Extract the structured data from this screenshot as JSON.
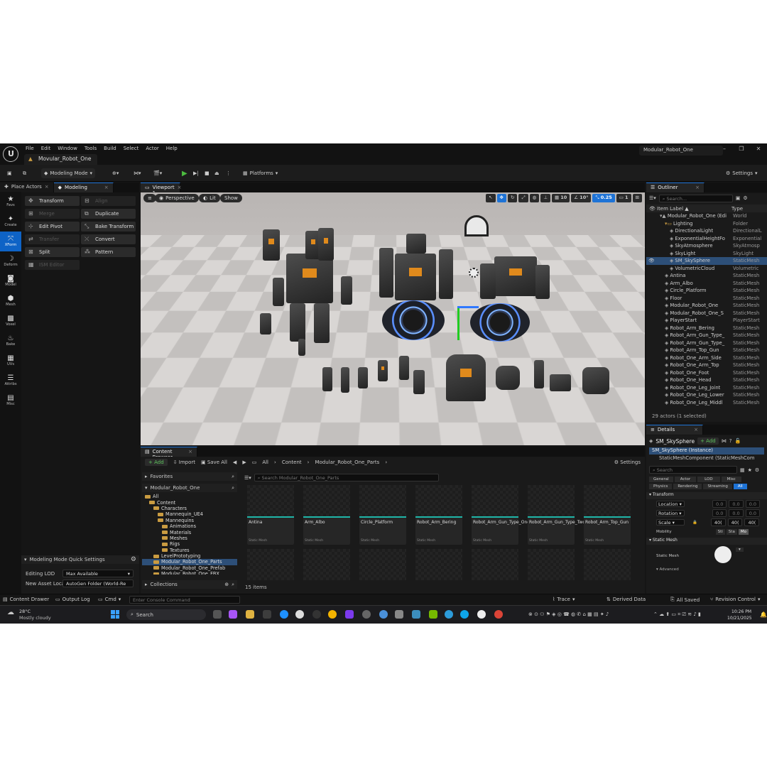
{
  "app": {
    "menus": [
      "File",
      "Edit",
      "Window",
      "Tools",
      "Build",
      "Select",
      "Actor",
      "Help"
    ],
    "project_tab": "Movular_Robot_One",
    "window_title": "Modular_Robot_One",
    "window_controls": [
      "–",
      "❐",
      "✕"
    ]
  },
  "toolbar": {
    "mode": "Modeling Mode",
    "platforms": "Platforms",
    "settings": "Settings"
  },
  "left_panel": {
    "tabs": [
      "Place Actors",
      "Modeling"
    ],
    "strip": [
      {
        "icon": "star-icon",
        "label": "Favs"
      },
      {
        "icon": "create-icon",
        "label": "Create"
      },
      {
        "icon": "xform-icon",
        "label": "XForm"
      },
      {
        "icon": "deform-icon",
        "label": "Deform"
      },
      {
        "icon": "model-icon",
        "label": "Model"
      },
      {
        "icon": "mesh-icon",
        "label": "Mesh"
      },
      {
        "icon": "voxel-icon",
        "label": "Voxel"
      },
      {
        "icon": "bake-icon",
        "label": "Bake"
      },
      {
        "icon": "uvs-icon",
        "label": "UVs"
      },
      {
        "icon": "attribs-icon",
        "label": "Attribs"
      },
      {
        "icon": "misc-icon",
        "label": "Misc"
      }
    ],
    "tools": [
      {
        "label": "Transform",
        "enabled": true
      },
      {
        "label": "Align",
        "enabled": false
      },
      {
        "label": "Merge",
        "enabled": false
      },
      {
        "label": "Duplicate",
        "enabled": true
      },
      {
        "label": "Edit Pivot",
        "enabled": true
      },
      {
        "label": "Bake Transform",
        "enabled": true
      },
      {
        "label": "Transfer",
        "enabled": false
      },
      {
        "label": "Convert",
        "enabled": true
      },
      {
        "label": "Split",
        "enabled": true
      },
      {
        "label": "Pattern",
        "enabled": true
      },
      {
        "label": "ISM Editor",
        "enabled": false
      }
    ],
    "quick_settings": {
      "title": "Modeling Mode Quick Settings",
      "editing_lod_label": "Editing LOD",
      "editing_lod_value": "Max Available",
      "new_asset_label": "New Asset Loca",
      "new_asset_value": "AutoGen Folder (World-Re"
    }
  },
  "viewport": {
    "tab": "Viewport 1",
    "perspective": "Perspective",
    "lit": "Lit",
    "show": "Show",
    "grid_snap": "10",
    "angle_snap": "10°",
    "scale_snap": "0.25",
    "camera_speed": "1"
  },
  "outliner": {
    "title": "Outliner",
    "search_placeholder": "Search...",
    "col_label": "Item Label ▲",
    "col_type": "Type",
    "rows": [
      {
        "name": "Modular_Robot_One (Edi",
        "type": "World",
        "indent": 1
      },
      {
        "name": "Lighting",
        "type": "Folder",
        "indent": 2
      },
      {
        "name": "DirectionalLight",
        "type": "DirectionalL",
        "indent": 3
      },
      {
        "name": "ExponentialHeightFo",
        "type": "Exponential",
        "indent": 3
      },
      {
        "name": "SkyAtmosphere",
        "type": "SkyAtmosp",
        "indent": 3
      },
      {
        "name": "SkyLight",
        "type": "SkyLight",
        "indent": 3
      },
      {
        "name": "SM_SkySphere",
        "type": "StaticMesh",
        "indent": 3,
        "selected": true
      },
      {
        "name": "VolumetricCloud",
        "type": "Volumetric",
        "indent": 3
      },
      {
        "name": "Antina",
        "type": "StaticMesh",
        "indent": 2
      },
      {
        "name": "Arm_Albo",
        "type": "StaticMesh",
        "indent": 2
      },
      {
        "name": "Circle_Platform",
        "type": "StaticMesh",
        "indent": 2
      },
      {
        "name": "Floor",
        "type": "StaticMesh",
        "indent": 2
      },
      {
        "name": "Modular_Robot_One",
        "type": "StaticMesh",
        "indent": 2
      },
      {
        "name": "Modular_Robot_One_S",
        "type": "StaticMesh",
        "indent": 2
      },
      {
        "name": "PlayerStart",
        "type": "PlayerStart",
        "indent": 2
      },
      {
        "name": "Robot_Arm_Bering",
        "type": "StaticMesh",
        "indent": 2
      },
      {
        "name": "Robot_Arm_Gun_Type_",
        "type": "StaticMesh",
        "indent": 2
      },
      {
        "name": "Robot_Arm_Gun_Type_",
        "type": "StaticMesh",
        "indent": 2
      },
      {
        "name": "Robot_Arm_Top_Gun",
        "type": "StaticMesh",
        "indent": 2
      },
      {
        "name": "Robot_One_Arm_Side",
        "type": "StaticMesh",
        "indent": 2
      },
      {
        "name": "Robot_One_Arm_Top",
        "type": "StaticMesh",
        "indent": 2
      },
      {
        "name": "Robot_One_Foot",
        "type": "StaticMesh",
        "indent": 2
      },
      {
        "name": "Robot_One_Head",
        "type": "StaticMesh",
        "indent": 2
      },
      {
        "name": "Robot_One_Leg_Joint",
        "type": "StaticMesh",
        "indent": 2
      },
      {
        "name": "Robot_One_Leg_Lower",
        "type": "StaticMesh",
        "indent": 2
      },
      {
        "name": "Robot_One_Leg_Middl",
        "type": "StaticMesh",
        "indent": 2
      }
    ],
    "footer": "29 actors (1 selected)"
  },
  "details": {
    "title": "Details",
    "actor": "SM_SkySphere",
    "add": "+ Add",
    "instance": "SM_SkySphere (Instance)",
    "component": "StaticMeshComponent (StaticMeshCom",
    "search_placeholder": "Search",
    "filters1": [
      "General",
      "Actor",
      "LOD",
      "Misc"
    ],
    "filters2": [
      "Physics",
      "Rendering",
      "Streaming",
      "All"
    ],
    "transform": "Transform",
    "location": "Location",
    "rotation": "Rotation",
    "scale": "Scale",
    "loc_vals": [
      "0.0",
      "0.0",
      "0.0"
    ],
    "rot_vals": [
      "0.0",
      "0.0",
      "0.0"
    ],
    "scale_vals": [
      "40(",
      "40(",
      "40("
    ],
    "mobility": "Mobility",
    "mobility_opts": [
      "Sti",
      "Sta",
      "Mo"
    ],
    "static_mesh_header": "Static Mesh",
    "static_mesh_label": "Static Mesh",
    "advanced": "Advanced"
  },
  "content_browser": {
    "tab": "Content Browser",
    "add": "+ Add",
    "import": "Import",
    "save_all": "Save All",
    "breadcrumb": [
      "All",
      "Content",
      "Modular_Robot_One_Parts"
    ],
    "settings": "Settings",
    "favorites": "Favorites",
    "root": "Modular_Robot_One",
    "search_placeholder": "Search Modular_Robot_One_Parts",
    "tree": [
      {
        "name": "All",
        "indent": 0
      },
      {
        "name": "Content",
        "indent": 1
      },
      {
        "name": "Characters",
        "indent": 2
      },
      {
        "name": "Mannequin_UE4",
        "indent": 3
      },
      {
        "name": "Mannequins",
        "indent": 3
      },
      {
        "name": "Animations",
        "indent": 4
      },
      {
        "name": "Materials",
        "indent": 4
      },
      {
        "name": "Meshes",
        "indent": 4
      },
      {
        "name": "Rigs",
        "indent": 4
      },
      {
        "name": "Textures",
        "indent": 4
      },
      {
        "name": "LevelPrototyping",
        "indent": 2
      },
      {
        "name": "Modular_Robot_One_Parts",
        "indent": 2,
        "selected": true
      },
      {
        "name": "Modular_Robot_One_Prefab",
        "indent": 2
      },
      {
        "name": "Modular_Robot_One_FBX",
        "indent": 2
      }
    ],
    "collections": "Collections",
    "items": [
      {
        "name": "Antina",
        "type": "Static Mesh"
      },
      {
        "name": "Arm_Albo",
        "type": "Static Mesh"
      },
      {
        "name": "Circle_Platform",
        "type": "Static Mesh"
      },
      {
        "name": "Robot_Arm_Bering",
        "type": "Static Mesh"
      },
      {
        "name": "Robot_Arm_Gun_Type_One",
        "type": "Static Mesh"
      },
      {
        "name": "Robot_Arm_Gun_Type_Two",
        "type": "Static Mesh"
      },
      {
        "name": "Robot_Arm_Top_Gun",
        "type": "Static Mesh"
      }
    ],
    "count": "15 items"
  },
  "statusbar": {
    "content_drawer": "Content Drawer",
    "output_log": "Output Log",
    "cmd": "Cmd",
    "console_placeholder": "Enter Console Command",
    "trace": "Trace",
    "derived": "Derived Data",
    "saved": "All Saved",
    "revision": "Revision Control"
  },
  "taskbar": {
    "temp": "28°C",
    "weather": "Mostly cloudy",
    "search": "Search",
    "time": "10:26 PM",
    "date": "10/21/2025"
  }
}
